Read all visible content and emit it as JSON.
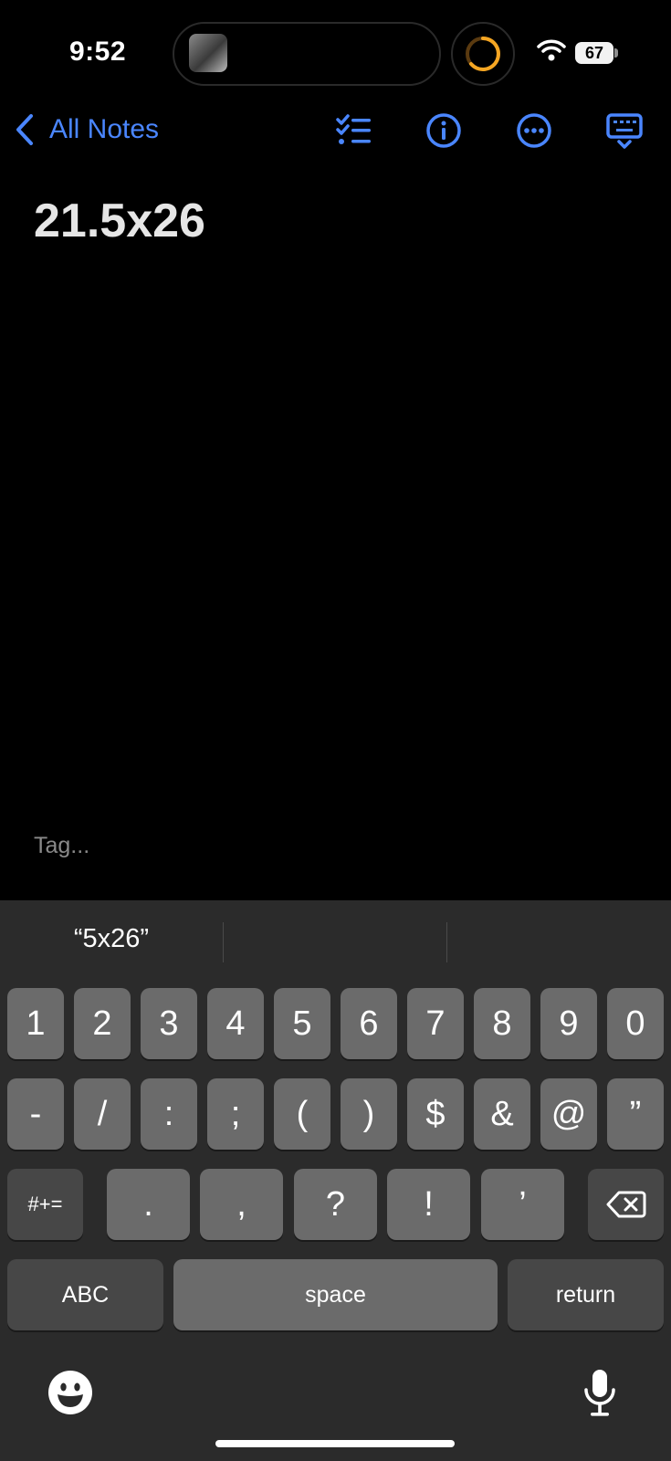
{
  "status_bar": {
    "time": "9:52",
    "battery": "67"
  },
  "nav": {
    "back_label": "All Notes"
  },
  "note": {
    "title": "21.5x26",
    "tag_placeholder": "Tag..."
  },
  "keyboard": {
    "suggestions": [
      "“5x26”",
      "",
      ""
    ],
    "row1": [
      "1",
      "2",
      "3",
      "4",
      "5",
      "6",
      "7",
      "8",
      "9",
      "0"
    ],
    "row2": [
      "-",
      "/",
      ":",
      ";",
      "(",
      ")",
      "$",
      "&",
      "@",
      "”"
    ],
    "row3": {
      "symbols": "#+=",
      "keys": [
        ".",
        ",",
        "?",
        "!",
        "’"
      ]
    },
    "row4": {
      "abc": "ABC",
      "space": "space",
      "return": "return"
    }
  },
  "colors": {
    "accent": "#4a86ff",
    "background": "#000000",
    "keyboard": "#2b2b2b",
    "key": "#6b6b6b",
    "key_dark": "#474747",
    "timer": "#f5a623"
  }
}
